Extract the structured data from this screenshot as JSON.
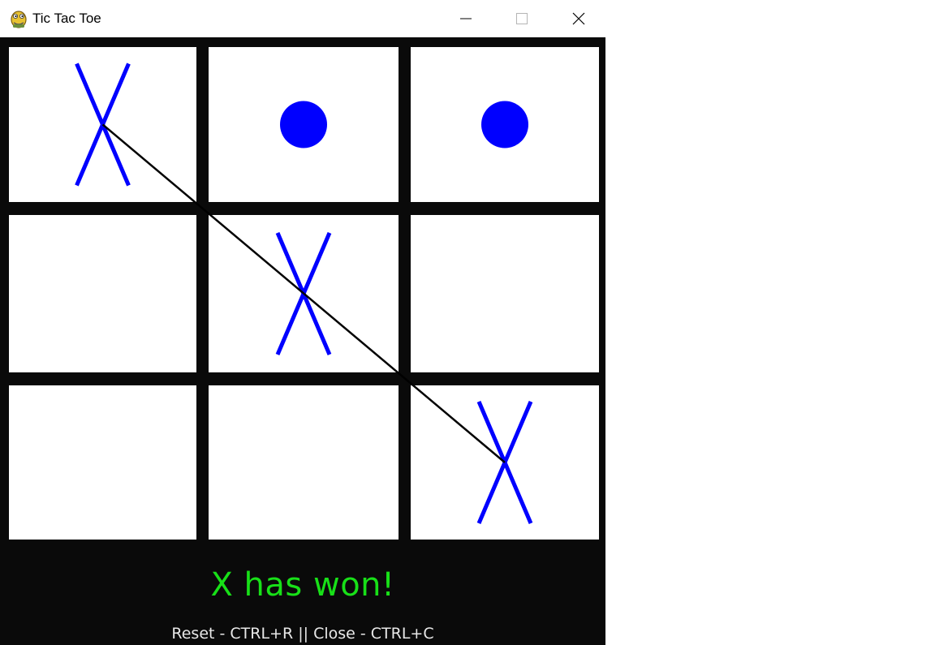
{
  "window": {
    "title": "Tic Tac Toe",
    "app_icon": "python-snake-icon",
    "controls": [
      "minimize-icon",
      "maximize-icon",
      "close-icon"
    ]
  },
  "board": {
    "rows": 3,
    "cols": 3,
    "cells": [
      "X",
      "O",
      "O",
      "",
      "X",
      "",
      "",
      "",
      "X"
    ],
    "win_line": {
      "from_cell": 0,
      "to_cell": 8,
      "direction": "diagonal"
    },
    "colors": {
      "background": "#0a0a0a",
      "cell": "#ffffff",
      "mark": "#0000ff",
      "win_line": "#000000"
    }
  },
  "status": {
    "message": "X has won!",
    "color": "#18e018"
  },
  "help": {
    "text": "Reset - CTRL+R || Close - CTRL+C"
  }
}
